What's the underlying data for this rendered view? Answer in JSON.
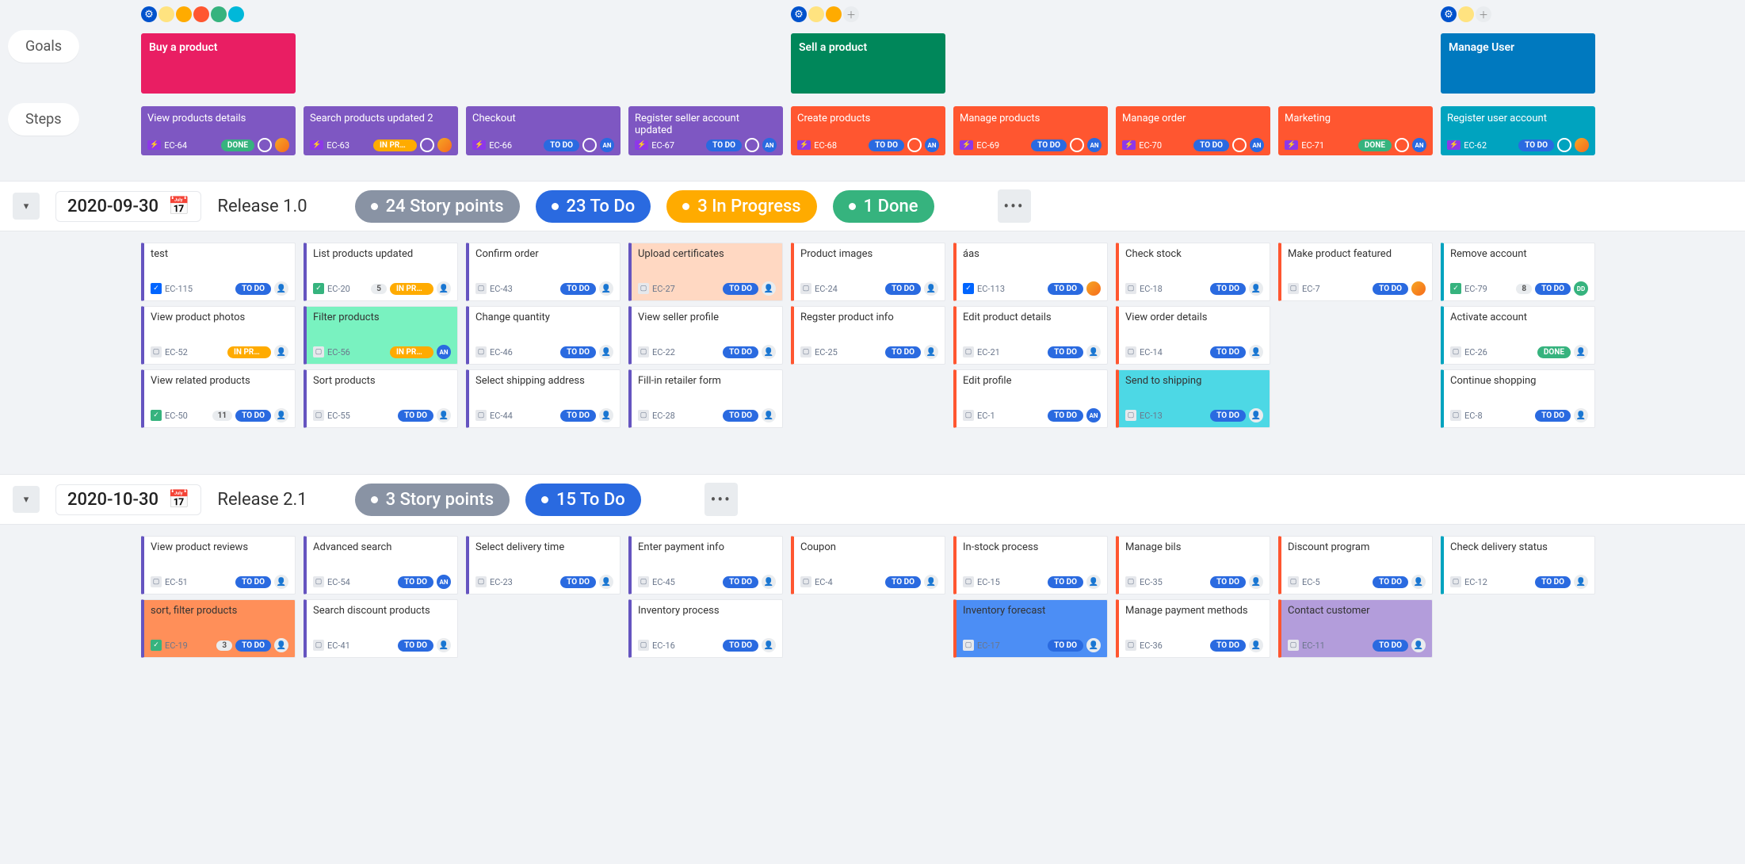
{
  "labels": {
    "goals": "Goals",
    "steps": "Steps"
  },
  "goals": [
    {
      "title": "Buy a product",
      "color": "goal-pink",
      "span_cols": [
        0,
        3
      ],
      "avatars": [
        "gear",
        "p1",
        "p2",
        "p3",
        "p4",
        "p5"
      ]
    },
    {
      "title": "Sell a product",
      "color": "goal-green",
      "span_cols": [
        4,
        7
      ],
      "avatars": [
        "gear",
        "p1",
        "p2",
        "add"
      ]
    },
    {
      "title": "Manage User",
      "color": "goal-blue",
      "span_cols": [
        8,
        8
      ],
      "avatars": [
        "gear",
        "p1",
        "add"
      ]
    }
  ],
  "steps": [
    {
      "title": "View products details",
      "key": "EC-64",
      "status": "DONE",
      "color": "step-purple",
      "av": "img"
    },
    {
      "title": "Search products updated 2",
      "key": "EC-63",
      "status": "IN PROG...",
      "color": "step-purple",
      "av": "img"
    },
    {
      "title": "Checkout",
      "key": "EC-66",
      "status": "TO DO",
      "color": "step-purple",
      "av": "AN"
    },
    {
      "title": "Register seller account updated",
      "key": "EC-67",
      "status": "TO DO",
      "color": "step-purple",
      "av": "AN"
    },
    {
      "title": "Create products",
      "key": "EC-68",
      "status": "TO DO",
      "color": "step-orange",
      "av": "AN"
    },
    {
      "title": "Manage products",
      "key": "EC-69",
      "status": "TO DO",
      "color": "step-orange",
      "av": "AN"
    },
    {
      "title": "Manage order",
      "key": "EC-70",
      "status": "TO DO",
      "color": "step-orange",
      "av": "AN"
    },
    {
      "title": "Marketing",
      "key": "EC-71",
      "status": "DONE",
      "color": "step-orange",
      "av": "AN"
    },
    {
      "title": "Register user account",
      "key": "EC-62",
      "status": "TO DO",
      "color": "step-teal",
      "av": "img"
    }
  ],
  "releases": [
    {
      "date": "2020-09-30",
      "name": "Release 1.0",
      "stats": [
        {
          "text": "24 Story points",
          "cls": "bp-grey"
        },
        {
          "text": "23 To Do",
          "cls": "bp-blue"
        },
        {
          "text": "3 In Progress",
          "cls": "bp-yellow"
        },
        {
          "text": "1 Done",
          "cls": "bp-green"
        }
      ],
      "columns": [
        [
          {
            "title": "test",
            "key": "EC-115",
            "status": "TO DO",
            "bl": "bl-purple",
            "type": "blue",
            "av": "u"
          },
          {
            "title": "View product photos",
            "key": "EC-52",
            "status": "IN PROG...",
            "bl": "bl-purple",
            "av": "u"
          },
          {
            "title": "View related products",
            "key": "EC-50",
            "status": "TO DO",
            "bl": "bl-purple",
            "pts": "11",
            "type": "green",
            "av": "u"
          }
        ],
        [
          {
            "title": "List products updated",
            "key": "EC-20",
            "status": "IN PROG...",
            "bl": "bl-purple",
            "pts": "5",
            "type": "green",
            "av": "u"
          },
          {
            "title": "Filter products",
            "key": "EC-56",
            "status": "IN PROG...",
            "bl": "bl-purple",
            "hl": "hl-green",
            "av": "AN"
          },
          {
            "title": "Sort products",
            "key": "EC-55",
            "status": "TO DO",
            "bl": "bl-purple",
            "av": "u"
          }
        ],
        [
          {
            "title": "Confirm order",
            "key": "EC-43",
            "status": "TO DO",
            "bl": "bl-purple",
            "av": "u"
          },
          {
            "title": "Change quantity",
            "key": "EC-46",
            "status": "TO DO",
            "bl": "bl-purple",
            "av": "u"
          },
          {
            "title": "Select shipping address",
            "key": "EC-44",
            "status": "TO DO",
            "bl": "bl-purple",
            "av": "u"
          }
        ],
        [
          {
            "title": "Upload certificates",
            "key": "EC-27",
            "status": "TO DO",
            "bl": "bl-purple",
            "hl": "hl-orange",
            "av": "u"
          },
          {
            "title": "View seller profile",
            "key": "EC-22",
            "status": "TO DO",
            "bl": "bl-purple",
            "av": "u"
          },
          {
            "title": "Fill-in retailer form",
            "key": "EC-28",
            "status": "TO DO",
            "bl": "bl-purple",
            "av": "u"
          }
        ],
        [
          {
            "title": "Product images",
            "key": "EC-24",
            "status": "TO DO",
            "bl": "bl-orange",
            "av": "u"
          },
          {
            "title": "Regster product info",
            "key": "EC-25",
            "status": "TO DO",
            "bl": "bl-orange",
            "av": "u"
          }
        ],
        [
          {
            "title": "áas",
            "key": "EC-113",
            "status": "TO DO",
            "bl": "bl-orange",
            "type": "blue",
            "av": "img"
          },
          {
            "title": "Edit product details",
            "key": "EC-21",
            "status": "TO DO",
            "bl": "bl-orange",
            "av": "u"
          },
          {
            "title": "Edit profile",
            "key": "EC-1",
            "status": "TO DO",
            "bl": "bl-orange",
            "av": "AN"
          }
        ],
        [
          {
            "title": "Check stock",
            "key": "EC-18",
            "status": "TO DO",
            "bl": "bl-orange",
            "av": "u"
          },
          {
            "title": "View order details",
            "key": "EC-14",
            "status": "TO DO",
            "bl": "bl-orange",
            "av": "u"
          },
          {
            "title": "Send to shipping",
            "key": "EC-13",
            "status": "TO DO",
            "bl": "bl-orange",
            "hl": "hl-cyan",
            "av": "u"
          }
        ],
        [
          {
            "title": "Make product featured",
            "key": "EC-7",
            "status": "TO DO",
            "bl": "bl-orange",
            "av": "img"
          }
        ],
        [
          {
            "title": "Remove account",
            "key": "EC-79",
            "status": "TO DO",
            "bl": "bl-teal",
            "pts": "8",
            "type": "green",
            "av": "DD"
          },
          {
            "title": "Activate account",
            "key": "EC-26",
            "status": "DONE",
            "bl": "bl-teal",
            "av": "u"
          },
          {
            "title": "Continue shopping",
            "key": "EC-8",
            "status": "TO DO",
            "bl": "bl-teal",
            "av": "u"
          }
        ]
      ]
    },
    {
      "date": "2020-10-30",
      "name": "Release 2.1",
      "stats": [
        {
          "text": "3 Story points",
          "cls": "bp-grey"
        },
        {
          "text": "15 To Do",
          "cls": "bp-blue"
        }
      ],
      "columns": [
        [
          {
            "title": "View product reviews",
            "key": "EC-51",
            "status": "TO DO",
            "bl": "bl-purple",
            "av": "u"
          },
          {
            "title": "sort, filter products",
            "key": "EC-19",
            "status": "TO DO",
            "bl": "bl-purple",
            "pts": "3",
            "type": "green",
            "hl": "hl-orangefull",
            "av": "u"
          }
        ],
        [
          {
            "title": "Advanced search",
            "key": "EC-54",
            "status": "TO DO",
            "bl": "bl-purple",
            "av": "AN"
          },
          {
            "title": "Search discount products",
            "key": "EC-41",
            "status": "TO DO",
            "bl": "bl-purple",
            "av": "u"
          }
        ],
        [
          {
            "title": "Select delivery time",
            "key": "EC-23",
            "status": "TO DO",
            "bl": "bl-purple",
            "av": "u"
          }
        ],
        [
          {
            "title": "Enter payment info",
            "key": "EC-45",
            "status": "TO DO",
            "bl": "bl-purple",
            "av": "u"
          },
          {
            "title": "Inventory process",
            "key": "EC-16",
            "status": "TO DO",
            "bl": "bl-purple",
            "av": "u"
          }
        ],
        [
          {
            "title": "Coupon",
            "key": "EC-4",
            "status": "TO DO",
            "bl": "bl-orange",
            "av": "u"
          }
        ],
        [
          {
            "title": "In-stock process",
            "key": "EC-15",
            "status": "TO DO",
            "bl": "bl-orange",
            "av": "u"
          },
          {
            "title": "Inventory forecast",
            "key": "EC-17",
            "status": "TO DO",
            "bl": "bl-orange",
            "hl": "hl-blue",
            "av": "u"
          }
        ],
        [
          {
            "title": "Manage bils",
            "key": "EC-35",
            "status": "TO DO",
            "bl": "bl-orange",
            "av": "u"
          },
          {
            "title": "Manage payment methods",
            "key": "EC-36",
            "status": "TO DO",
            "bl": "bl-orange",
            "av": "u"
          }
        ],
        [
          {
            "title": "Discount program",
            "key": "EC-5",
            "status": "TO DO",
            "bl": "bl-orange",
            "av": "u"
          },
          {
            "title": "Contact customer",
            "key": "EC-11",
            "status": "TO DO",
            "bl": "bl-orange",
            "hl": "hl-purple",
            "av": "u"
          }
        ],
        [
          {
            "title": "Check delivery status",
            "key": "EC-12",
            "status": "TO DO",
            "bl": "bl-teal",
            "av": "u"
          }
        ]
      ]
    }
  ]
}
